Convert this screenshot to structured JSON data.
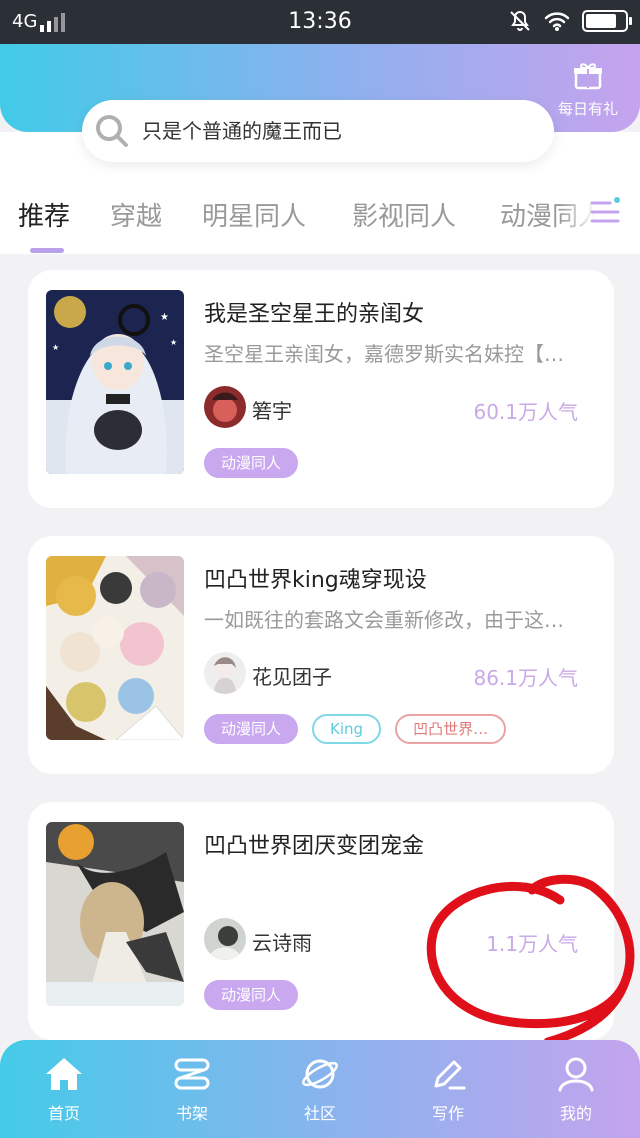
{
  "status_bar": {
    "network": "4G",
    "time": "13:36"
  },
  "header": {
    "daily_gift_label": "每日有礼",
    "search_placeholder": "只是个普通的魔王而已"
  },
  "tabs": [
    "推荐",
    "穿越",
    "明星同人",
    "影视同人",
    "动漫同人"
  ],
  "books": [
    {
      "title": "我是圣空星王的亲闺女",
      "description": "圣空星王亲闺女，嘉德罗斯实名妹控【…",
      "author": "箬宇",
      "popularity": "60.1万人气",
      "tags": [
        "动漫同人"
      ]
    },
    {
      "title": "凹凸世界king魂穿现设",
      "description": "一如既往的套路文会重新修改，由于这…",
      "author": "花见团子",
      "popularity": "86.1万人气",
      "tags": [
        "动漫同人",
        "King",
        "凹凸世界…"
      ]
    },
    {
      "title": "凹凸世界团厌变团宠金",
      "description": "",
      "author": "云诗雨",
      "popularity": "1.1万人气",
      "tags": [
        "动漫同人"
      ]
    }
  ],
  "bottom_nav": [
    {
      "label": "首页",
      "icon": "home-icon"
    },
    {
      "label": "书架",
      "icon": "bookshelf-icon"
    },
    {
      "label": "社区",
      "icon": "planet-icon"
    },
    {
      "label": "写作",
      "icon": "pen-icon"
    },
    {
      "label": "我的",
      "icon": "user-icon"
    }
  ],
  "colors": {
    "accent_purple": "#c9a8f0",
    "header_gradient_start": "#41cbe8",
    "header_gradient_end": "#c6a3ee",
    "popularity_text": "#c9a9e6",
    "annotation_red": "#e0101a"
  }
}
